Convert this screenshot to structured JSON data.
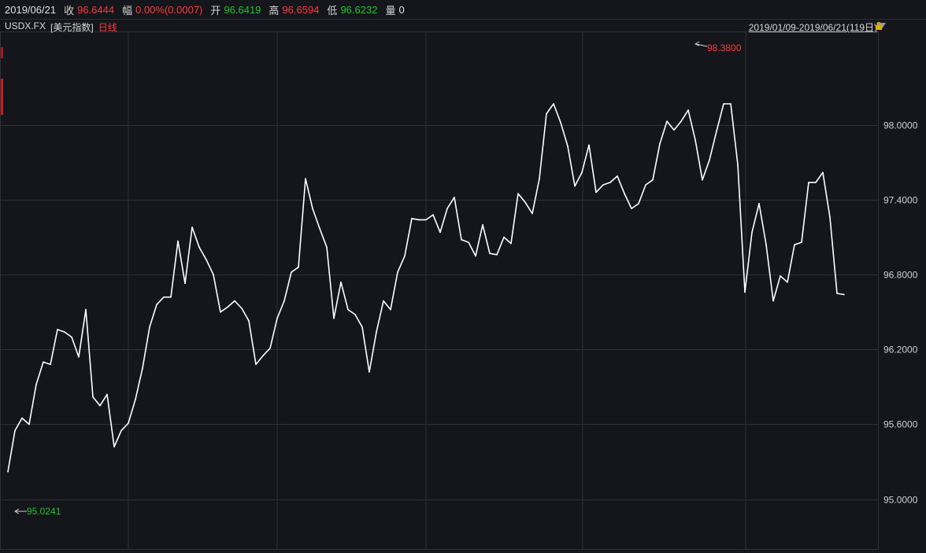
{
  "info": {
    "date": "2019/06/21",
    "close_label": "收",
    "close_value": "96.6444",
    "change_label": "幅",
    "change_value": "0.00%(0.0007)",
    "open_label": "开",
    "open_value": "96.6419",
    "high_label": "高",
    "high_value": "96.6594",
    "low_label": "低",
    "low_value": "96.6232",
    "volume_label": "量",
    "volume_value": "0"
  },
  "symbol": {
    "code": "USDX.FX",
    "name": "[美元指数]",
    "period": "日线"
  },
  "range": {
    "label": "2019/01/09-2019/06/21(119日)"
  },
  "annotations": {
    "max_label": "98.3800",
    "min_label": "95.0241"
  },
  "colors": {
    "background": "#14161b",
    "line": "#ffffff",
    "up": "#ff3a3a",
    "down": "#21c42a",
    "grid": "#2c3038"
  },
  "chart_data": {
    "type": "line",
    "title": "",
    "xlabel": "",
    "ylabel": "",
    "ylim": [
      94.6,
      98.75
    ],
    "yticks": [
      "98.0000",
      "97.4000",
      "96.8000",
      "96.2000",
      "95.6000",
      "95.0000"
    ],
    "ytick_values": [
      98.0,
      97.4,
      96.8,
      96.2,
      95.6,
      95.0
    ],
    "grid": true,
    "series": [
      {
        "name": "",
        "values": [
          95.22,
          95.55,
          95.65,
          95.6,
          95.92,
          96.1,
          96.08,
          96.36,
          96.34,
          96.3,
          96.14,
          96.52,
          95.82,
          95.75,
          95.84,
          95.42,
          95.55,
          95.61,
          95.8,
          96.05,
          96.38,
          96.56,
          96.62,
          96.62,
          97.07,
          96.73,
          97.18,
          97.02,
          96.92,
          96.8,
          96.5,
          96.54,
          96.59,
          96.53,
          96.43,
          96.08,
          96.15,
          96.21,
          96.45,
          96.59,
          96.82,
          96.86,
          97.57,
          97.33,
          97.17,
          97.02,
          96.45,
          96.74,
          96.52,
          96.48,
          96.38,
          96.02,
          96.34,
          96.59,
          96.52,
          96.82,
          96.95,
          97.25,
          97.24,
          97.24,
          97.28,
          97.14,
          97.33,
          97.42,
          97.08,
          97.06,
          96.95,
          97.2,
          96.97,
          96.96,
          97.1,
          97.05,
          97.45,
          97.38,
          97.29,
          97.57,
          98.09,
          98.17,
          98.02,
          97.83,
          97.51,
          97.62,
          97.84,
          97.46,
          97.52,
          97.54,
          97.59,
          97.45,
          97.33,
          97.37,
          97.52,
          97.56,
          97.85,
          98.03,
          97.96,
          98.03,
          98.12,
          97.88,
          97.56,
          97.72,
          97.95,
          98.17,
          98.17,
          97.68,
          96.66,
          97.14,
          97.37,
          97.04,
          96.59,
          96.79,
          96.74,
          97.04,
          97.06,
          97.54,
          97.54,
          97.62,
          97.26,
          96.65,
          96.64
        ]
      }
    ]
  }
}
